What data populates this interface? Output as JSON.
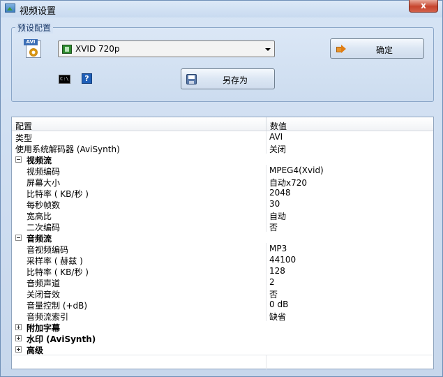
{
  "window": {
    "title": "视频设置",
    "close_label": "x"
  },
  "preset": {
    "group_label": "预设配置",
    "avi_badge": "AVI",
    "profile_value": "XVID 720p",
    "ok_label": "确定",
    "save_as_label": "另存为",
    "cmd_icon_text": "C:\\",
    "help_icon_text": "?"
  },
  "grid": {
    "col_name": "配置",
    "col_value": "数值",
    "rows": [
      {
        "type": "item",
        "name": "类型",
        "value": "AVI"
      },
      {
        "type": "item",
        "name": "使用系统解码器 (AviSynth)",
        "value": "关闭"
      },
      {
        "type": "category",
        "name": "视频流",
        "expanded": true
      },
      {
        "type": "child",
        "name": "视频编码",
        "value": "MPEG4(Xvid)"
      },
      {
        "type": "child",
        "name": "屏幕大小",
        "value": "自动x720"
      },
      {
        "type": "child",
        "name": "比特率 ( KB/秒 )",
        "value": "2048"
      },
      {
        "type": "child",
        "name": "每秒帧数",
        "value": "30"
      },
      {
        "type": "child",
        "name": "宽高比",
        "value": "自动"
      },
      {
        "type": "child",
        "name": "二次编码",
        "value": "否"
      },
      {
        "type": "category",
        "name": "音频流",
        "expanded": true
      },
      {
        "type": "child",
        "name": "音视频编码",
        "value": "MP3"
      },
      {
        "type": "child",
        "name": "采样率 ( 赫兹 )",
        "value": "44100"
      },
      {
        "type": "child",
        "name": "比特率 ( KB/秒 )",
        "value": "128"
      },
      {
        "type": "child",
        "name": "音频声道",
        "value": "2"
      },
      {
        "type": "child",
        "name": "关闭音效",
        "value": "否"
      },
      {
        "type": "child",
        "name": "音量控制 (+dB)",
        "value": "0 dB"
      },
      {
        "type": "child",
        "name": "音频流索引",
        "value": "缺省"
      },
      {
        "type": "category",
        "name": "附加字幕",
        "expanded": false
      },
      {
        "type": "category",
        "name": "水印 (AviSynth)",
        "expanded": false
      },
      {
        "type": "category",
        "name": "高级",
        "expanded": false
      }
    ]
  },
  "colors": {
    "window_bg": "#c9d9ee",
    "title_text": "#000000",
    "group_label": "#1a3a6a",
    "close_button": "#c7452e",
    "grid_bg": "#ffffff"
  },
  "icons": {
    "title": "video-settings-icon",
    "avi": "avi-file-icon",
    "film": "film-icon",
    "ok": "arrow-right-icon",
    "save": "floppy-disk-icon",
    "cmd": "command-prompt-icon",
    "help": "help-icon"
  }
}
